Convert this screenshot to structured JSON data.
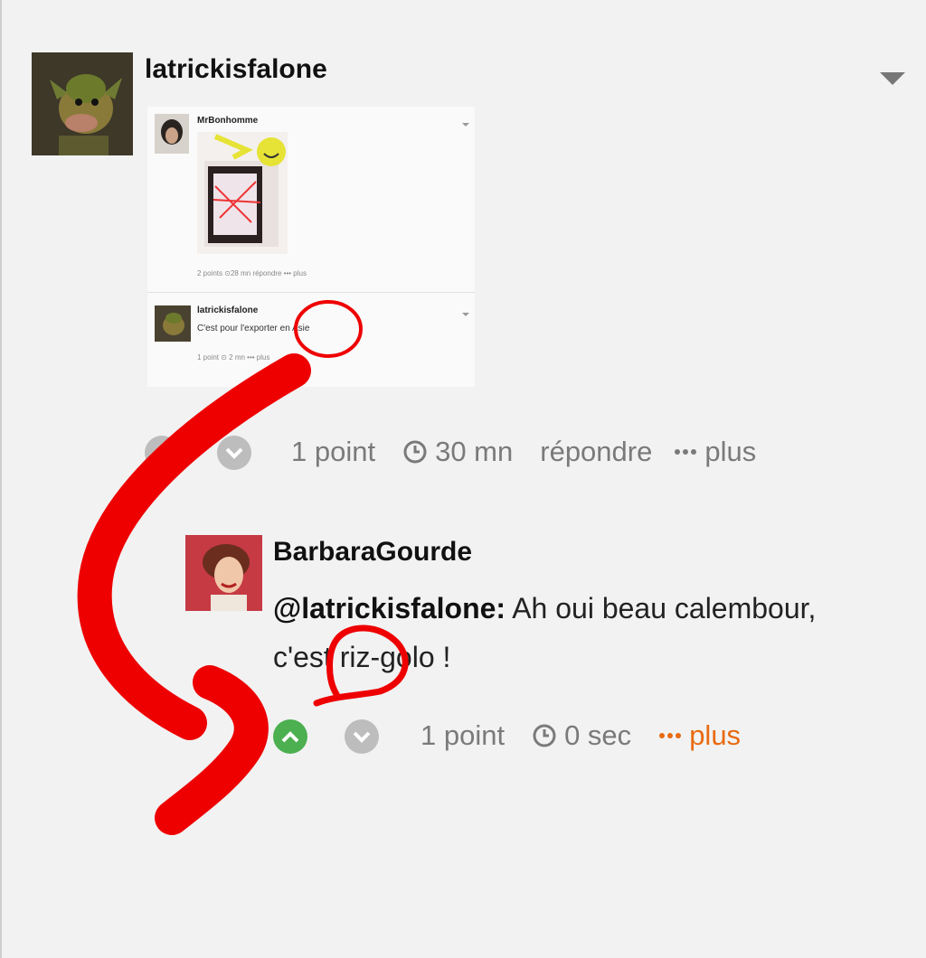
{
  "comment1": {
    "username": "latrickisfalone",
    "votes": "1 point",
    "time": "30 mn",
    "reply": "répondre",
    "more": "plus",
    "embedded": {
      "first": {
        "username": "MrBonhomme",
        "meta": "2 points  ⊙28 mn  répondre  ••• plus"
      },
      "second": {
        "username": "latrickisfalone",
        "text": "C'est pour l'exporter en Asie",
        "meta": "1 point  ⊙ 2 mn  ••• plus"
      }
    }
  },
  "comment2": {
    "username": "BarbaraGourde",
    "mention": "@latrickisfalone:",
    "text_line1": " Ah oui beau calembour,",
    "text_line2": "c'est riz-golo !",
    "votes": "1 point",
    "time": "0 sec",
    "more": "plus"
  },
  "colors": {
    "upvote_active": "#4caf50",
    "vote_inactive": "#bdbdbd",
    "accent_orange": "#e86a10",
    "annotation_red": "#ee0000"
  },
  "icons": [
    "caret-down-icon",
    "upvote-icon",
    "downvote-icon",
    "clock-icon",
    "more-dots-icon"
  ]
}
